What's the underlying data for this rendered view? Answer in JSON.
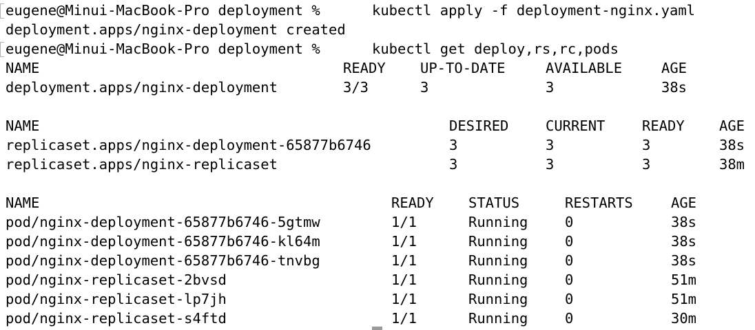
{
  "terminal": {
    "prompt": "eugene@Minui-MacBook-Pro deployment %",
    "commands": [
      {
        "text": "kubectl apply -f deployment-nginx.yaml"
      },
      {
        "text": "kubectl get deploy,rs,rc,pods"
      }
    ],
    "apply_output": "deployment.apps/nginx-deployment created",
    "deploy_table": {
      "headers": [
        "NAME",
        "READY",
        "UP-TO-DATE",
        "AVAILABLE",
        "AGE"
      ],
      "rows": [
        [
          "deployment.apps/nginx-deployment",
          "3/3",
          "3",
          "3",
          "38s"
        ]
      ]
    },
    "rs_table": {
      "headers": [
        "NAME",
        "DESIRED",
        "CURRENT",
        "READY",
        "AGE"
      ],
      "rows": [
        [
          "replicaset.apps/nginx-deployment-65877b6746",
          "3",
          "3",
          "3",
          "38s"
        ],
        [
          "replicaset.apps/nginx-replicaset",
          "3",
          "3",
          "3",
          "38m"
        ]
      ]
    },
    "pod_table": {
      "headers": [
        "NAME",
        "READY",
        "STATUS",
        "RESTARTS",
        "AGE"
      ],
      "rows": [
        [
          "pod/nginx-deployment-65877b6746-5gtmw",
          "1/1",
          "Running",
          "0",
          "38s"
        ],
        [
          "pod/nginx-deployment-65877b6746-kl64m",
          "1/1",
          "Running",
          "0",
          "38s"
        ],
        [
          "pod/nginx-deployment-65877b6746-tnvbg",
          "1/1",
          "Running",
          "0",
          "38s"
        ],
        [
          "pod/nginx-replicaset-2bvsd",
          "1/1",
          "Running",
          "0",
          "51m"
        ],
        [
          "pod/nginx-replicaset-lp7jh",
          "1/1",
          "Running",
          "0",
          "51m"
        ],
        [
          "pod/nginx-replicaset-s4ftd",
          "1/1",
          "Running",
          "0",
          "30m"
        ]
      ]
    }
  }
}
